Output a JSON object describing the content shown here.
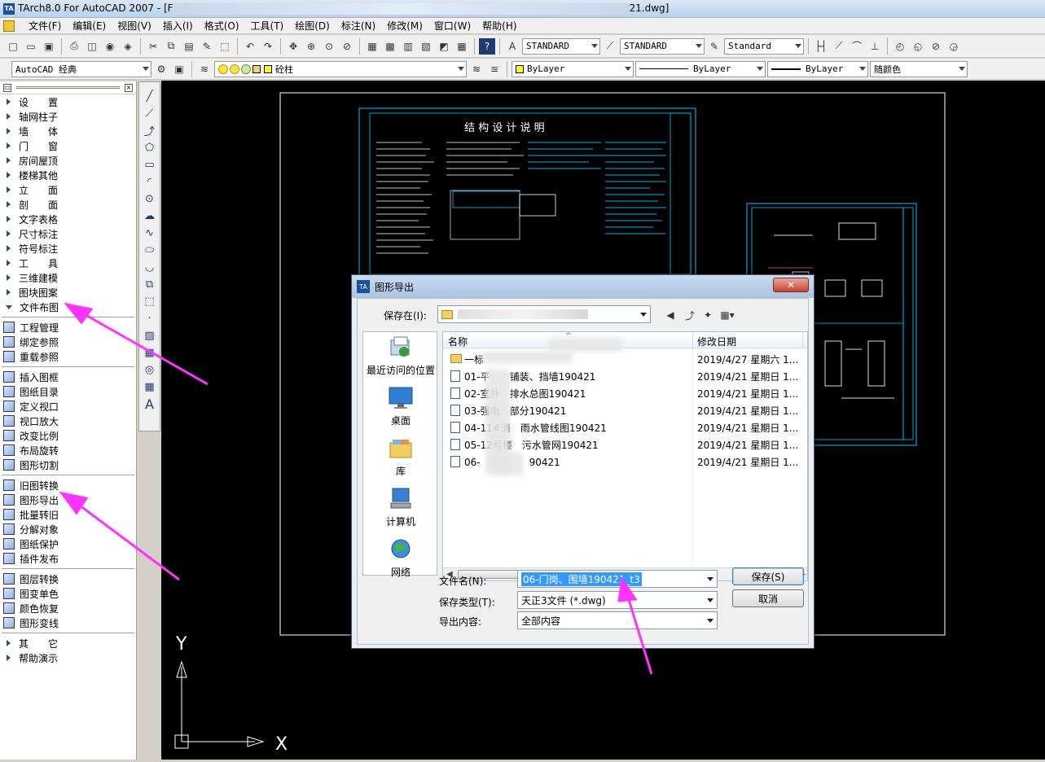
{
  "window": {
    "title_prefix": "TArch8.0 For AutoCAD 2007 - [F",
    "title_suffix": "21.dwg]"
  },
  "menu": [
    "文件(F)",
    "编辑(E)",
    "视图(V)",
    "插入(I)",
    "格式(O)",
    "工具(T)",
    "绘图(D)",
    "标注(N)",
    "修改(M)",
    "窗口(W)",
    "帮助(H)"
  ],
  "toolbar": {
    "text_style": "STANDARD",
    "dim_style": "STANDARD",
    "table_style": "Standard",
    "workspace": "AutoCAD 经典",
    "layer": "砼柱",
    "color": "ByLayer",
    "linetype": "ByLayer",
    "lineweight": "ByLayer",
    "plot_style": "随颜色"
  },
  "sidebar": {
    "group1": [
      "设　　置",
      "轴网柱子",
      "墙　　体",
      "门　　窗",
      "房间屋顶",
      "楼梯其他",
      "立　　面",
      "剖　　面",
      "文字表格",
      "尺寸标注",
      "符号标注",
      "工　　具",
      "三维建模",
      "图块图案"
    ],
    "expanded": "文件布图",
    "group2": [
      "工程管理",
      "绑定参照",
      "重载参照"
    ],
    "group3": [
      "插入图框",
      "图纸目录",
      "定义视口",
      "视口放大",
      "改变比例",
      "布局旋转",
      "图形切割"
    ],
    "group4": [
      "旧图转换",
      "图形导出",
      "批量转旧",
      "分解对象",
      "图纸保护",
      "插件发布"
    ],
    "group5": [
      "图层转换",
      "图变单色",
      "颜色恢复",
      "图形变线"
    ],
    "group6": [
      "其　　它",
      "帮助演示"
    ]
  },
  "drawing": {
    "sheet_title": "结 构 设 计 说 明",
    "axis_x": "X",
    "axis_y": "Y"
  },
  "dialog": {
    "title": "图形导出",
    "save_in_label": "保存在(I):",
    "places": [
      "最近访问的位置",
      "桌面",
      "库",
      "计算机",
      "网络"
    ],
    "col_name": "名称",
    "col_date": "修改日期",
    "files": [
      {
        "name": "一标",
        "date": "2019/4/27 星期六 1...",
        "type": "folder"
      },
      {
        "name": "01-平　　铺装、挡墙190421",
        "date": "2019/4/21 星期日 1...",
        "type": "file"
      },
      {
        "name": "02-室外　排水总图190421",
        "date": "2019/4/21 星期日 1...",
        "type": "file"
      },
      {
        "name": "03-强电　部分190421",
        "date": "2019/4/21 星期日 1...",
        "type": "file"
      },
      {
        "name": "04-11#消　雨水管线图190421",
        "date": "2019/4/21 星期日 1...",
        "type": "file"
      },
      {
        "name": "05-12号楼　污水管网190421",
        "date": "2019/4/21 星期日 1...",
        "type": "file"
      },
      {
        "name": "06-　　　　　90421",
        "date": "2019/4/21 星期日 1...",
        "type": "file"
      }
    ],
    "filename_label": "文件名(N):",
    "filename_value": "06-门岗、围墙190421_t3",
    "filetype_label": "保存类型(T):",
    "filetype_value": "天正3文件 (*.dwg)",
    "content_label": "导出内容:",
    "content_value": "全部内容",
    "save_button": "保存(S)",
    "cancel_button": "取消"
  }
}
